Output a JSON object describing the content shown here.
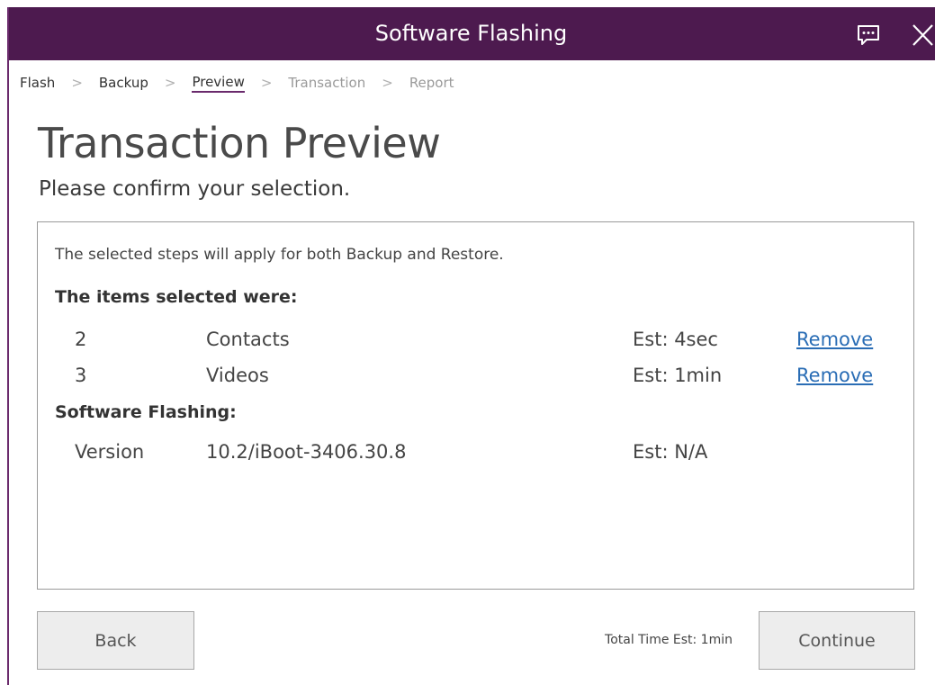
{
  "window": {
    "title": "Software Flashing",
    "accent_color": "#4d1a4f",
    "chat_icon": "chat-bubble-icon",
    "close_icon": "close-icon"
  },
  "breadcrumb": {
    "items": [
      {
        "label": "Flash",
        "state": "done"
      },
      {
        "label": "Backup",
        "state": "done"
      },
      {
        "label": "Preview",
        "state": "current"
      },
      {
        "label": "Transaction",
        "state": "upcoming"
      },
      {
        "label": "Report",
        "state": "upcoming"
      }
    ],
    "separator": ">"
  },
  "page": {
    "title": "Transaction Preview",
    "subtitle": "Please confirm your selection."
  },
  "details": {
    "intro": "The selected steps will apply for both Backup and Restore.",
    "items_heading": "The items selected were:",
    "items": [
      {
        "count": "2",
        "name": "Contacts",
        "estimate": "Est: 4sec",
        "action": "Remove"
      },
      {
        "count": "3",
        "name": "Videos",
        "estimate": "Est: 1min",
        "action": "Remove"
      }
    ],
    "flashing_heading": "Software Flashing:",
    "flashing": {
      "label": "Version",
      "value": "10.2/iBoot-3406.30.8",
      "estimate": "Est: N/A"
    },
    "link_color": "#2a6db5"
  },
  "footer": {
    "back_label": "Back",
    "total_time": "Total Time Est: 1min",
    "continue_label": "Continue"
  }
}
